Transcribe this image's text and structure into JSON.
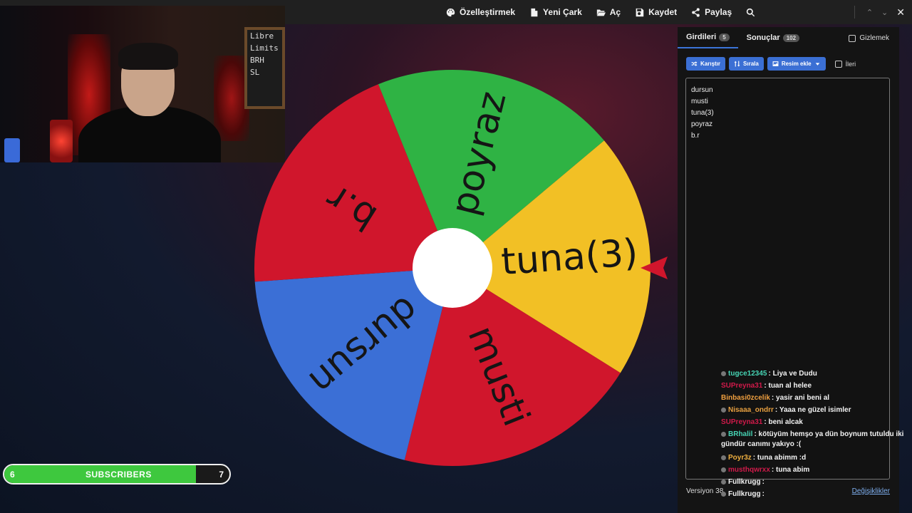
{
  "toolbar": {
    "items": [
      {
        "label": "Özelleştirmek",
        "icon": "palette-icon"
      },
      {
        "label": "Yeni Çark",
        "icon": "file-icon"
      },
      {
        "label": "Aç",
        "icon": "folder-open-icon"
      },
      {
        "label": "Kaydet",
        "icon": "save-icon"
      },
      {
        "label": "Paylaş",
        "icon": "share-icon"
      }
    ],
    "search_icon": "search-icon",
    "window_controls": {
      "up": "⌃",
      "down": "⌄",
      "close": "✕"
    }
  },
  "webcam": {
    "board_lines": [
      "Libre",
      "Limits",
      "BRH",
      "SL"
    ]
  },
  "wheel": {
    "segments": [
      {
        "label": "poyraz",
        "color": "#2fb344"
      },
      {
        "label": "tuna(3)",
        "color": "#f2c025"
      },
      {
        "label": "musti",
        "color": "#d0162c"
      },
      {
        "label": "dursun",
        "color": "#3b6fd6"
      },
      {
        "label": "b.r",
        "color": "#d0162c"
      }
    ],
    "pointer_color": "#d0162c"
  },
  "panel": {
    "tabs": [
      {
        "label": "Girdileri",
        "count": "5"
      },
      {
        "label": "Sonuçlar",
        "count": "102"
      }
    ],
    "hide_label": "Gizlemek",
    "buttons": {
      "shuffle": "Karıştır",
      "sort": "Sırala",
      "add_image": "Resim ekle"
    },
    "advanced_label": "İleri",
    "entries": [
      "dursun",
      "musti",
      "tuna(3)",
      "poyraz",
      "b.r"
    ],
    "version_label": "Versiyon 38",
    "changes_label": "Değişiklikler"
  },
  "chat": {
    "messages": [
      {
        "user": "tugce12345",
        "user_color": "#46d4b4",
        "text": ": Liya ve Dudu"
      },
      {
        "user": "SUPreyna31",
        "user_color": "#d01a4a",
        "text": ": tuan al helee"
      },
      {
        "user": "Binbasi0zcelik",
        "user_color": "#f0a040",
        "text": ": yasir ani beni al"
      },
      {
        "user": "Nisaaa_ondrr",
        "user_color": "#e8a040",
        "text": ": Yaaa ne güzel isimler"
      },
      {
        "user": "SUPreyna31",
        "user_color": "#d01a4a",
        "text": ": beni alcak"
      },
      {
        "user": "BRhalil",
        "user_color": "#46d4b4",
        "text": ": kötüyüm hemşo ya dün boynum tutuldu iki gündür canımı yakıyo :("
      },
      {
        "user": "Poyr3z",
        "user_color": "#f0b040",
        "text": ": tuna abimm :d"
      },
      {
        "user": "musthqwrxx",
        "user_color": "#d01a4a",
        "text": ": tuna abim"
      },
      {
        "user": "Fullkrugg",
        "user_color": "#f3f3f3",
        "text": ":"
      },
      {
        "user": "Fullkrugg",
        "user_color": "#f3f3f3",
        "text": ":"
      },
      {
        "user": "Fullkrugg",
        "user_color": "#f3f3f3",
        "text": ":"
      }
    ]
  },
  "subscribers": {
    "current": "6",
    "label": "SUBSCRIBERS",
    "goal": "7",
    "progress": 0.85,
    "bar_color": "#3ec83e"
  }
}
